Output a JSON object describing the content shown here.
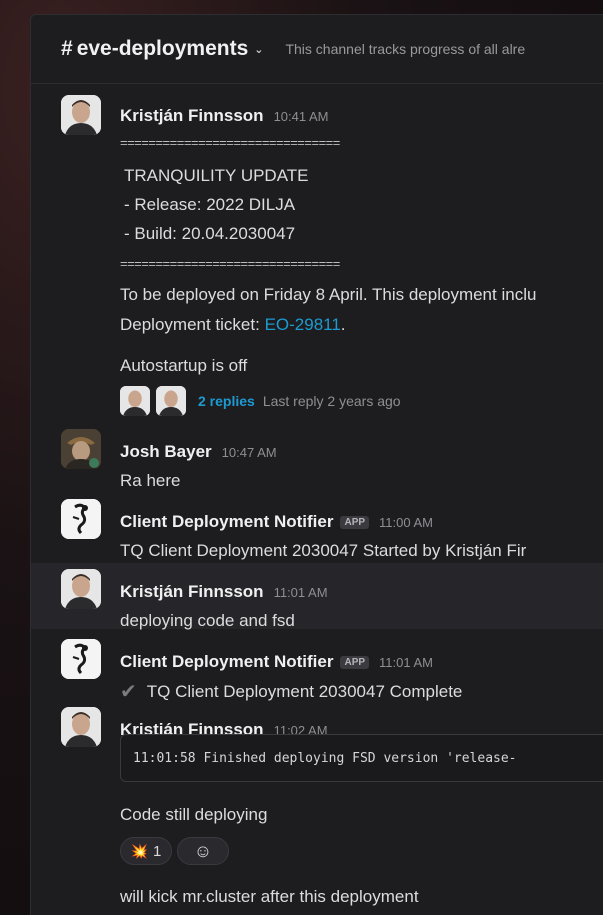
{
  "channel": {
    "name": "eve-deployments",
    "topic": "This channel tracks progress of all alre"
  },
  "messages": [
    {
      "author": "Kristján Finnsson",
      "time": "10:41 AM",
      "sep1": "===============================",
      "line1": "TRANQUILITY UPDATE",
      "line2": "- Release: 2022 DILJA",
      "line3": "- Build: 20.04.2030047",
      "sep2": "===============================",
      "line4": "To be deployed on Friday 8 April. This deployment inclu",
      "ticket_prefix": "Deployment ticket: ",
      "ticket_link": "EO-29811",
      "ticket_suffix": ".",
      "line5": "Autostartup is off",
      "replies": "2 replies",
      "last_reply": "Last reply 2 years ago"
    },
    {
      "author": "Josh Bayer",
      "time": "10:47 AM",
      "text": "Ra here"
    },
    {
      "author": "Client Deployment Notifier",
      "badge": "APP",
      "time": "11:00 AM",
      "text": "TQ Client Deployment 2030047 Started by Kristján Fir"
    },
    {
      "author": "Kristján Finnsson",
      "time": "11:01 AM",
      "text": "deploying code and fsd"
    },
    {
      "author": "Client Deployment Notifier",
      "badge": "APP",
      "time": "11:01 AM",
      "check": "✔",
      "text": "TQ Client Deployment 2030047 Complete"
    },
    {
      "author": "Kristján Finnsson",
      "time": "11:02 AM",
      "code": "11:01:58 Finished deploying FSD version 'release-",
      "text": "Code still deploying",
      "reaction_emoji": "💥",
      "reaction_count": "1",
      "add_reaction": "☺",
      "followup": "will kick mr.cluster after this deployment"
    }
  ],
  "colors": {
    "link": "#1d9bd1",
    "background": "#1d1c1f",
    "highlight": "#26252a"
  }
}
